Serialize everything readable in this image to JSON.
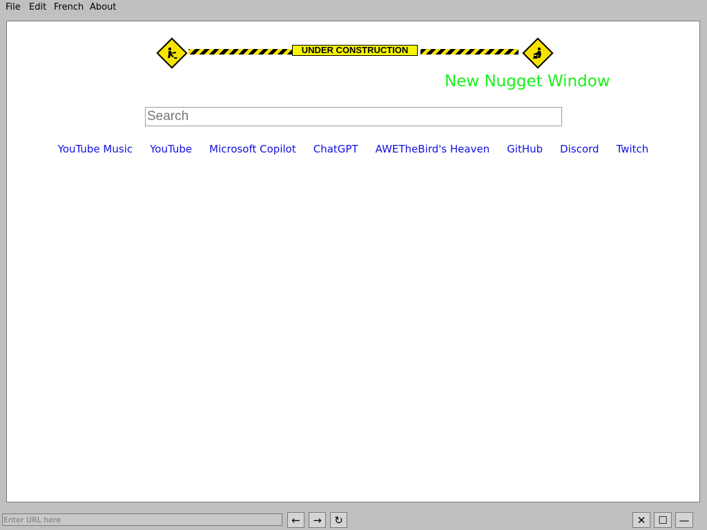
{
  "menubar": {
    "items": [
      "File",
      "Edit",
      "French",
      "About"
    ]
  },
  "banner": {
    "label": "UNDER CONSTRUCTION",
    "left_icon": "construction-sign-icon",
    "right_icon": "construction-sign-icon",
    "colors": {
      "tape_yellow": "#f6e300",
      "tape_black": "#000000"
    }
  },
  "page": {
    "title": "New Nugget Window",
    "title_color": "#19f019",
    "search_placeholder": "Search",
    "links": [
      "YouTube Music",
      "YouTube",
      "Microsoft Copilot",
      "ChatGPT",
      "AWETheBird's Heaven",
      "GitHub",
      "Discord",
      "Twitch"
    ],
    "link_color": "#1010e0"
  },
  "bottombar": {
    "url_placeholder": "Enter URL here",
    "back_icon": "arrow-left-icon",
    "back_glyph": "←",
    "forward_icon": "arrow-right-icon",
    "forward_glyph": "→",
    "reload_icon": "reload-icon",
    "reload_glyph": "↻",
    "close_glyph": "✕",
    "maximize_glyph": "☐",
    "minimize_glyph": "—"
  }
}
